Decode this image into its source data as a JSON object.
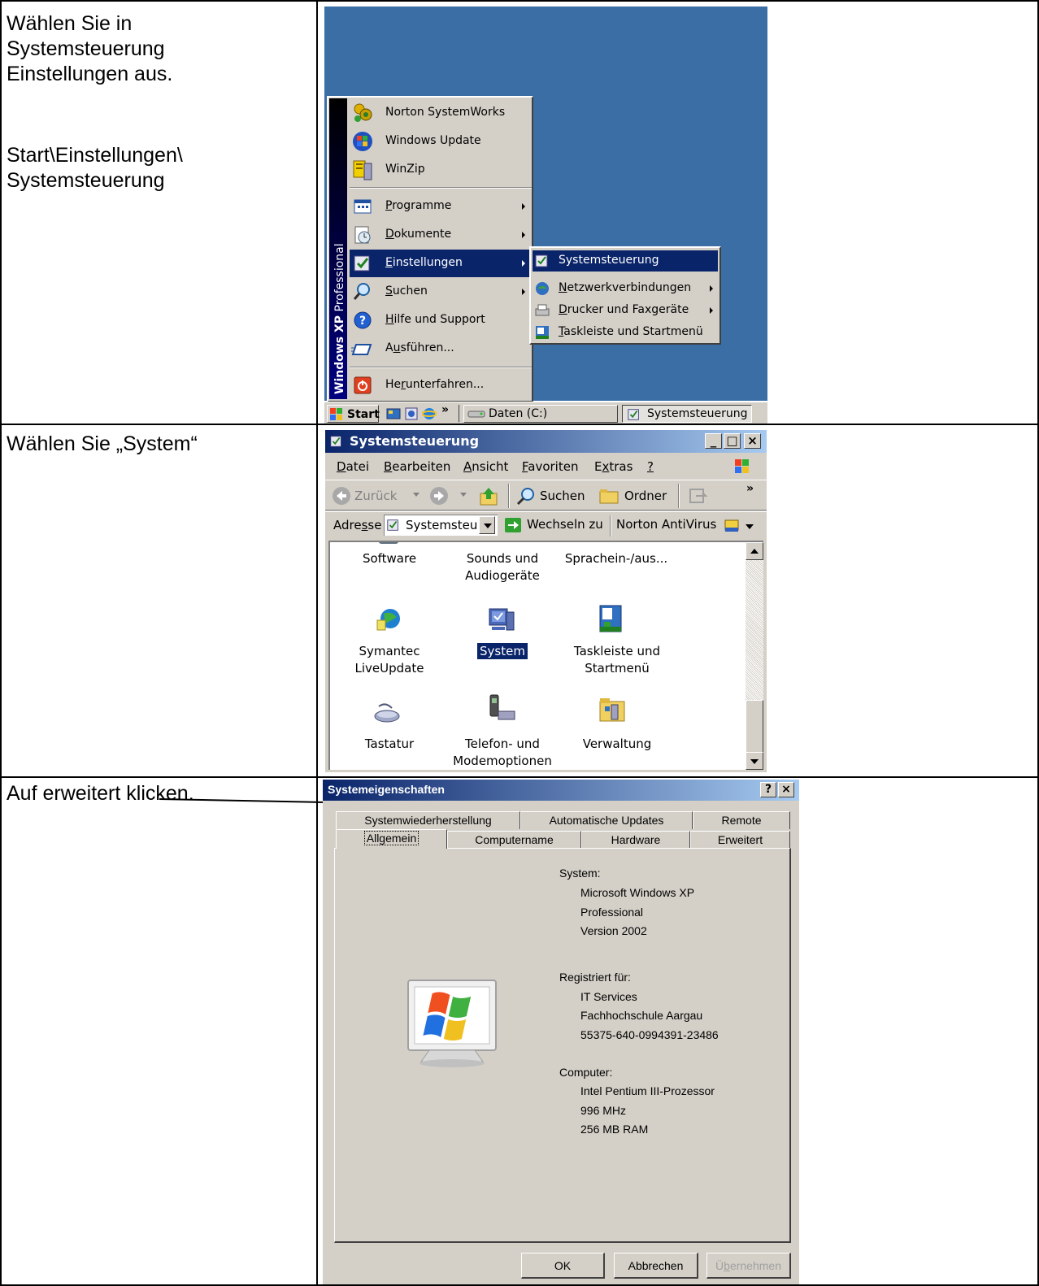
{
  "instructions": {
    "step1": [
      "Wählen Sie in",
      "Systemsteuerung",
      "Einstellungen aus."
    ],
    "step1_path": [
      "Start\\Einstellungen\\",
      "Systemsteuerung"
    ],
    "step2": "Wählen Sie „System“",
    "step3": "Auf erweitert klicken."
  },
  "start_menu": {
    "banner": "Windows XP Professional",
    "banner_bold": "Windows XP",
    "banner_rest": "Professional",
    "top_items": [
      {
        "label": "Norton SystemWorks",
        "icon": "norton-icon"
      },
      {
        "label": "Windows Update",
        "icon": "windows-update-icon"
      },
      {
        "label": "WinZip",
        "icon": "winzip-icon"
      }
    ],
    "items": [
      {
        "label": "Programme",
        "accel": "P",
        "rest": "rogramme",
        "icon": "programs-icon",
        "submenu": true
      },
      {
        "label": "Dokumente",
        "accel": "D",
        "rest": "okumente",
        "icon": "documents-icon",
        "submenu": true
      },
      {
        "label": "Einstellungen",
        "accel": "E",
        "rest": "instellungen",
        "icon": "settings-icon",
        "submenu": true,
        "selected": true
      },
      {
        "label": "Suchen",
        "accel": "S",
        "rest": "uchen",
        "icon": "search-icon",
        "submenu": true
      },
      {
        "label": "Hilfe und Support",
        "accel": "H",
        "rest": "ilfe und Support",
        "icon": "help-icon"
      },
      {
        "label": "Ausführen...",
        "pre": "A",
        "accel": "u",
        "rest": "sführen...",
        "icon": "run-icon"
      }
    ],
    "shutdown": {
      "label": "Herunterfahren...",
      "pre": "He",
      "accel": "r",
      "rest": "unterfahren...",
      "icon": "shutdown-icon"
    }
  },
  "settings_submenu": {
    "items": [
      {
        "label": "Systemsteuerung",
        "icon": "control-panel-icon",
        "selected": true
      },
      {
        "label": "Netzwerkverbindungen",
        "accel": "N",
        "rest": "etzwerkverbindungen",
        "icon": "network-icon",
        "submenu": true
      },
      {
        "label": "Drucker und Faxgeräte",
        "accel": "D",
        "rest": "rucker und Faxgeräte",
        "icon": "printer-icon",
        "submenu": true
      },
      {
        "label": "Taskleiste und Startmenü",
        "accel": "T",
        "rest": "askleiste und Startmenü",
        "icon": "taskbar-icon"
      }
    ]
  },
  "taskbar": {
    "start_label": "Start",
    "overflow": "»",
    "tasks": [
      {
        "label": "Daten (C:)",
        "icon": "drive-icon"
      },
      {
        "label": "Systemsteuerung",
        "icon": "control-panel-icon"
      }
    ]
  },
  "control_panel": {
    "title": "Systemsteuerung",
    "menu": [
      {
        "accel": "D",
        "rest": "atei"
      },
      {
        "accel": "B",
        "rest": "earbeiten"
      },
      {
        "accel": "A",
        "rest": "nsicht"
      },
      {
        "accel": "F",
        "rest": "avoriten"
      },
      {
        "pre": "E",
        "accel": "x",
        "rest": "tras"
      },
      {
        "accel": "?",
        "rest": ""
      }
    ],
    "toolbar": {
      "back": "Zurück",
      "search": "Suchen",
      "folders": "Ordner",
      "more": "»"
    },
    "address": {
      "label_pre": "Adre",
      "label_accel": "s",
      "label_rest": "se",
      "value": "Systemsteu",
      "go": "Wechseln zu",
      "norton": "Norton AntiVirus"
    },
    "items": [
      {
        "lines": [
          "Software"
        ],
        "icon": "software-icon"
      },
      {
        "lines": [
          "Sounds und",
          "Audiogeräte"
        ],
        "icon": "sounds-icon"
      },
      {
        "lines": [
          "Sprachein-/aus..."
        ],
        "icon": "speech-icon"
      },
      {
        "lines": [
          "Symantec",
          "LiveUpdate"
        ],
        "icon": "liveupdate-icon"
      },
      {
        "lines": [
          "System"
        ],
        "icon": "system-icon",
        "selected": true
      },
      {
        "lines": [
          "Taskleiste und",
          "Startmenü"
        ],
        "icon": "taskbar-icon"
      },
      {
        "lines": [
          "Tastatur"
        ],
        "icon": "keyboard-icon"
      },
      {
        "lines": [
          "Telefon- und",
          "Modemoptionen"
        ],
        "icon": "phone-modem-icon"
      },
      {
        "lines": [
          "Verwaltung"
        ],
        "icon": "admin-tools-icon"
      }
    ]
  },
  "system_properties": {
    "title": "Systemeigenschaften",
    "help_btn": "?",
    "close_btn": "×",
    "tabs_back": [
      "Systemwiederherstellung",
      "Automatische Updates",
      "Remote"
    ],
    "tabs_front": [
      "Allgemein",
      "Computername",
      "Hardware",
      "Erweitert"
    ],
    "active_tab": "Allgemein",
    "system_label": "System:",
    "system_lines": [
      "Microsoft Windows XP",
      "Professional",
      "Version 2002"
    ],
    "registered_label": "Registriert für:",
    "registered_lines": [
      "IT Services",
      "Fachhochschule Aargau",
      "55375-640-0994391-23486"
    ],
    "computer_label": "Computer:",
    "computer_lines": [
      "Intel Pentium III-Prozessor",
      "996 MHz",
      "256 MB RAM"
    ],
    "buttons": {
      "ok": "OK",
      "cancel": "Abbrechen",
      "apply": "Übernehmen",
      "apply_pre": "Ü",
      "apply_accel": "b",
      "apply_rest": "ernehmen"
    }
  },
  "colors": {
    "desktop": "#3a6ea5",
    "selection": "#0a246a",
    "window_face": "#d4d0c8",
    "titlebar_start": "#0a246a",
    "titlebar_end": "#a6caf0"
  }
}
